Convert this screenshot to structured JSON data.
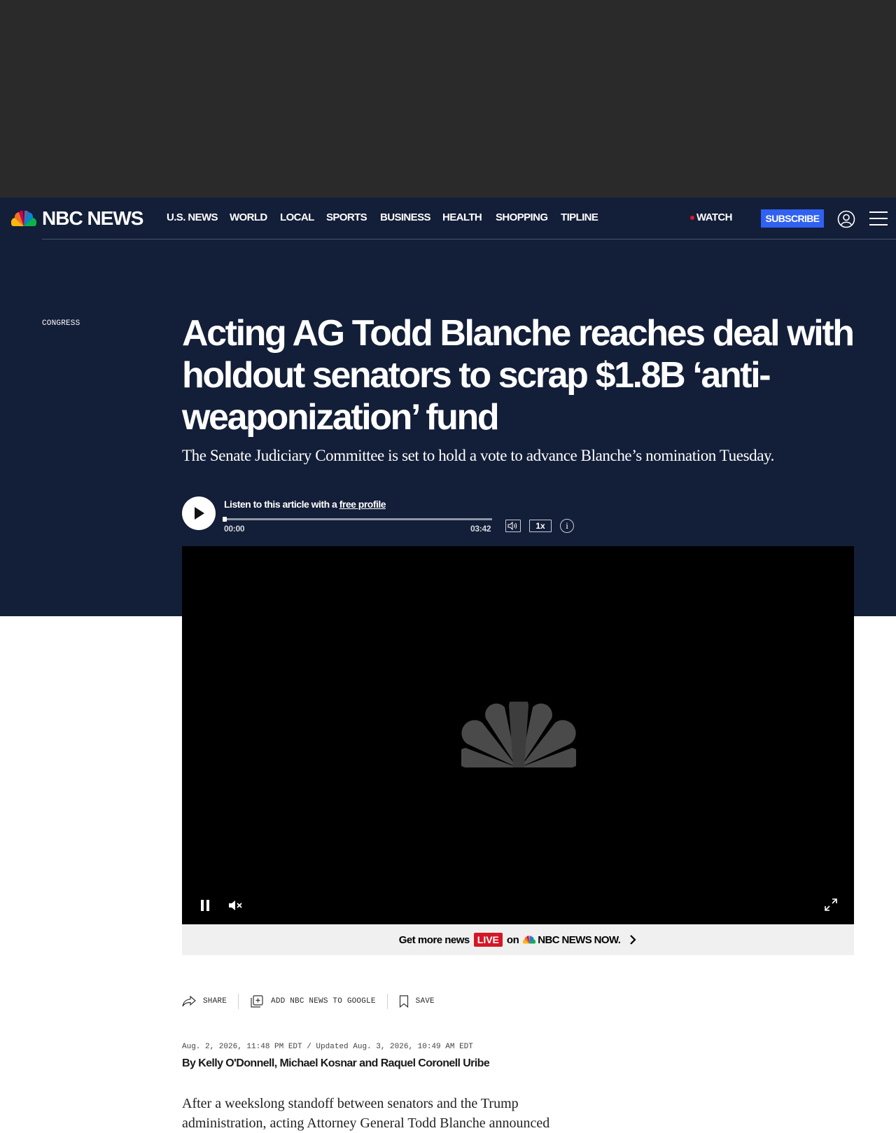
{
  "nav": {
    "brand": "NBC NEWS",
    "items": [
      "U.S. NEWS",
      "WORLD",
      "LOCAL",
      "SPORTS",
      "BUSINESS",
      "HEALTH",
      "SHOPPING",
      "TIPLINE"
    ],
    "watch": "WATCH",
    "subscribe": "SUBSCRIBE"
  },
  "article": {
    "category": "CONGRESS",
    "headline": "Acting AG Todd Blanche reaches deal with holdout senators to scrap $1.8B ‘anti-weaponization’ fund",
    "dek": "The Senate Judiciary Committee is set to hold a vote to advance Blanche’s nomination Tuesday.",
    "dateline": "Aug. 2, 2026, 11:48 PM EDT / Updated Aug. 3, 2026, 10:49 AM EDT",
    "byline_prefix": "By",
    "authors": [
      "Kelly O'Donnell",
      "Michael Kosnar",
      "Raquel Coronell Uribe"
    ],
    "byline_sep_1": ",",
    "byline_sep_2": "and",
    "body_first": "After a weekslong standoff between senators and the Trump administration, acting Attorney General Todd Blanche announced"
  },
  "audio": {
    "label": "Listen to this article with a",
    "link": "free profile",
    "current": "00:00",
    "duration": "03:42",
    "speed": "1x",
    "info": "i",
    "progress": 0
  },
  "video": {
    "state": "playing",
    "muted": true
  },
  "livebar": {
    "prefix": "Get more news",
    "live": "LIVE",
    "on": "on",
    "brand": "NBC NEWS NOW."
  },
  "share": {
    "share": "SHARE",
    "google": "ADD NBC NEWS TO GOOGLE",
    "save": "SAVE"
  },
  "colors": {
    "hero_bg": "#131e38",
    "subscribe": "#3061f2",
    "live_red": "#d31727",
    "ad_bg": "#2a2a2a"
  },
  "icons": [
    "peacock-logo-icon",
    "live-dot-icon",
    "account-icon",
    "hamburger-menu-icon",
    "play-icon",
    "volume-icon",
    "info-icon",
    "pause-icon",
    "mute-icon",
    "fullscreen-icon",
    "chevron-right-icon",
    "share-icon",
    "add-google-icon",
    "bookmark-icon"
  ]
}
